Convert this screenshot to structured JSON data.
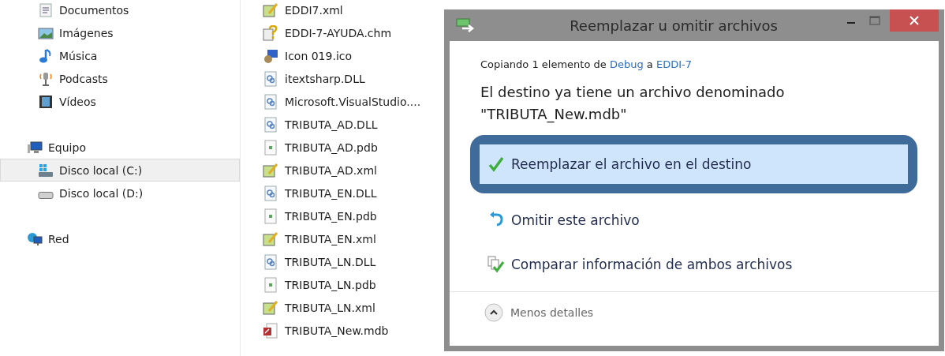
{
  "sidebar": {
    "library_items": [
      {
        "label": "Documentos",
        "kind": "document",
        "selected": false
      },
      {
        "label": "Imágenes",
        "kind": "image",
        "selected": false
      },
      {
        "label": "Música",
        "kind": "music",
        "selected": false
      },
      {
        "label": "Podcasts",
        "kind": "podcast",
        "selected": false
      },
      {
        "label": "Vídeos",
        "kind": "video",
        "selected": false
      }
    ],
    "items": [
      {
        "label": "Equipo",
        "kind": "computer",
        "selected": false,
        "children": [
          {
            "label": "Disco local (C:)",
            "kind": "system",
            "selected": true
          },
          {
            "label": "Disco local (D:)",
            "kind": "drive",
            "selected": false
          }
        ]
      },
      {
        "label": "Red",
        "kind": "network",
        "selected": false
      }
    ]
  },
  "files": [
    {
      "name": "EDDI7.xml",
      "kind": "xml"
    },
    {
      "name": "EDDI-7-AYUDA.chm",
      "kind": "help"
    },
    {
      "name": "Icon 019.ico",
      "kind": "icon"
    },
    {
      "name": "itextsharp.DLL",
      "kind": "dll"
    },
    {
      "name": "Microsoft.VisualStudio....",
      "kind": "dll"
    },
    {
      "name": "TRIBUTA_AD.DLL",
      "kind": "dll"
    },
    {
      "name": "TRIBUTA_AD.pdb",
      "kind": "pdb"
    },
    {
      "name": "TRIBUTA_AD.xml",
      "kind": "xml"
    },
    {
      "name": "TRIBUTA_EN.DLL",
      "kind": "dll"
    },
    {
      "name": "TRIBUTA_EN.pdb",
      "kind": "pdb"
    },
    {
      "name": "TRIBUTA_EN.xml",
      "kind": "xml"
    },
    {
      "name": "TRIBUTA_LN.DLL",
      "kind": "dll"
    },
    {
      "name": "TRIBUTA_LN.pdb",
      "kind": "pdb"
    },
    {
      "name": "TRIBUTA_LN.xml",
      "kind": "xml"
    },
    {
      "name": "TRIBUTA_New.mdb",
      "kind": "mdb"
    }
  ],
  "dialog": {
    "title": "Reemplazar u omitir archivos",
    "copying": {
      "text": "Copiando 1 elemento de",
      "source": "Debug",
      "joiner": "a",
      "destination": "EDDI-7"
    },
    "message": "El destino ya tiene un archivo denominado \"TRIBUTA_New.mdb\"",
    "options": [
      {
        "label": "Reemplazar el archivo en el destino",
        "kind": "replace",
        "selected": true
      },
      {
        "label": "Omitir este archivo",
        "kind": "skip",
        "selected": false
      },
      {
        "label": "Comparar información de ambos archivos",
        "kind": "compare",
        "selected": false
      }
    ],
    "details_toggle": {
      "label": "Menos detalles",
      "expanded": true
    }
  }
}
